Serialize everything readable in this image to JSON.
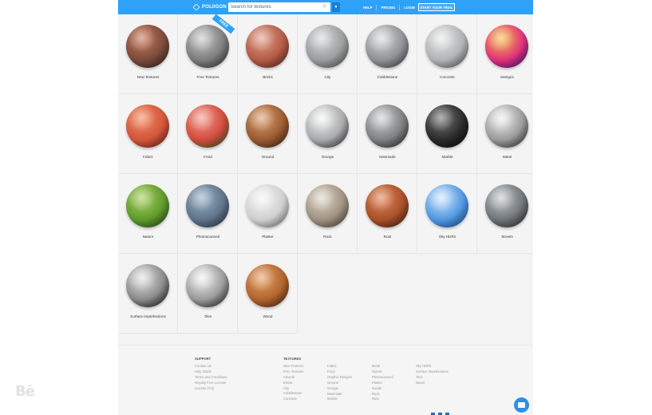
{
  "header": {
    "logo_text": "POLIIGON",
    "search_placeholder": "Search for textures",
    "nav": [
      "HELP",
      "PRICING",
      "LOGIN"
    ],
    "trial_label": "START YOUR TRIAL",
    "colors": {
      "bar": "#2ea1f8"
    }
  },
  "categories": [
    {
      "label": "New Textures",
      "colors": [
        "#c87a5c",
        "#7a4a3b",
        "#3d2a24"
      ]
    },
    {
      "label": "Free Textures",
      "badge": "FREE",
      "colors": [
        "#c9c9c9",
        "#7d7d7d",
        "#3a3a3a"
      ]
    },
    {
      "label": "Bricks",
      "colors": [
        "#e0a08a",
        "#b25a45",
        "#6b3025"
      ]
    },
    {
      "label": "City",
      "colors": [
        "#d5d7d8",
        "#9a9c9e",
        "#5c5e60"
      ]
    },
    {
      "label": "Cobblestone",
      "colors": [
        "#d8d9da",
        "#8f9194",
        "#4d4f52"
      ]
    },
    {
      "label": "Concrete",
      "colors": [
        "#e8e8e8",
        "#b0b2b4",
        "#6a6c6e"
      ]
    },
    {
      "label": "Designs",
      "colors": [
        "#f3c24a",
        "#e0307a",
        "#3a1a8a"
      ]
    },
    {
      "label": "Fabric",
      "colors": [
        "#f08a63",
        "#d2553a",
        "#7a2a1a"
      ]
    },
    {
      "label": "Food",
      "colors": [
        "#f29c90",
        "#d24a3c",
        "#2f6e2a"
      ]
    },
    {
      "label": "Ground",
      "colors": [
        "#d9a172",
        "#9a5a30",
        "#4a2a14"
      ]
    },
    {
      "label": "Grunge",
      "colors": [
        "#f4f4f4",
        "#a7a9ab",
        "#3a3c3e"
      ]
    },
    {
      "label": "Manmade",
      "colors": [
        "#cfd0d1",
        "#7d7f81",
        "#2e3032"
      ]
    },
    {
      "label": "Marble",
      "colors": [
        "#777777",
        "#2a2a2a",
        "#0a0a0a"
      ]
    },
    {
      "label": "Metal",
      "colors": [
        "#f0f0f0",
        "#9a9a9a",
        "#3a3a3a"
      ]
    },
    {
      "label": "Nature",
      "colors": [
        "#a8cf62",
        "#5f9a2c",
        "#2e5418"
      ]
    },
    {
      "label": "Photoscanned",
      "colors": [
        "#9ab0c4",
        "#5f7389",
        "#2f3d4c"
      ]
    },
    {
      "label": "Plaster",
      "colors": [
        "#f6f6f6",
        "#cfcfcf",
        "#8a8a8a"
      ]
    },
    {
      "label": "Rock",
      "colors": [
        "#ddd6c9",
        "#9e9180",
        "#5a5043"
      ]
    },
    {
      "label": "Rust",
      "colors": [
        "#e2875a",
        "#a8502a",
        "#4d2412"
      ]
    },
    {
      "label": "Sky HDRs",
      "colors": [
        "#cfe6fb",
        "#4f97e0",
        "#1d5aa8"
      ]
    },
    {
      "label": "Streets",
      "colors": [
        "#c4c8cc",
        "#6f7478",
        "#2e3236"
      ]
    },
    {
      "label": "Surface Imperfections",
      "colors": [
        "#e4e4e4",
        "#8a8a8a",
        "#1a1a1a"
      ]
    },
    {
      "label": "Tiles",
      "colors": [
        "#f2f2f2",
        "#9a9a9a",
        "#2a2a2a"
      ]
    },
    {
      "label": "Wood",
      "colors": [
        "#e4a26a",
        "#b0642e",
        "#5a2c12"
      ]
    }
  ],
  "footer": {
    "support_heading": "SUPPORT",
    "support_links": [
      "Contact Us",
      "Help Guide",
      "Terms and Conditions",
      "Royalty Free License",
      "License FAQ"
    ],
    "textures_heading": "TEXTURES",
    "tex_col1": [
      "New Textures",
      "Free Textures",
      "Artwork",
      "Bricks",
      "City",
      "Cobblestone",
      "Concrete"
    ],
    "tex_col2": [
      "Fabric",
      "Food",
      "Graphic Designs",
      "Ground",
      "Grunge",
      "Manmade",
      "Marble"
    ],
    "tex_col3": [
      "Metal",
      "Nature",
      "Photoscanned",
      "Plaster",
      "Roads",
      "Rock",
      "Rust"
    ],
    "tex_col4": [
      "Sky HDRs",
      "Surface Imperfections",
      "Tiles",
      "Wood"
    ]
  },
  "watermark": "Bē"
}
